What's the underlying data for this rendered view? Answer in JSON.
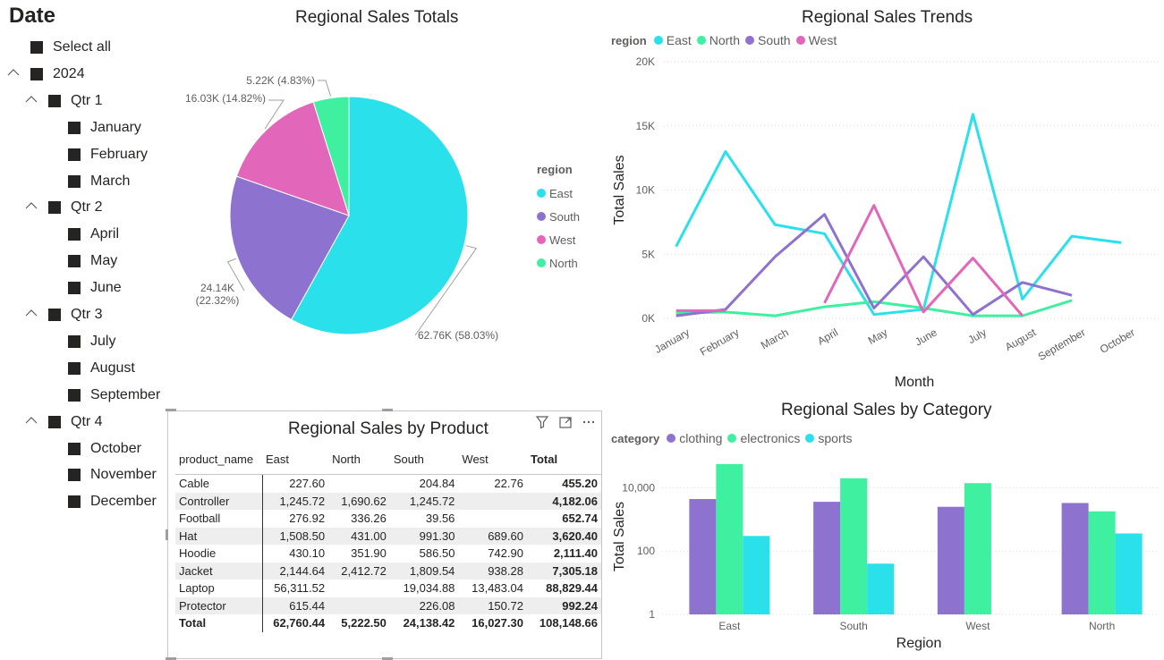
{
  "slicer": {
    "title": "Date",
    "items": [
      {
        "label": "Select all",
        "level": 0,
        "chevron": false
      },
      {
        "label": "2024",
        "level": 0,
        "chevron": true
      },
      {
        "label": "Qtr 1",
        "level": 1,
        "chevron": true
      },
      {
        "label": "January",
        "level": 2,
        "chevron": false
      },
      {
        "label": "February",
        "level": 2,
        "chevron": false
      },
      {
        "label": "March",
        "level": 2,
        "chevron": false
      },
      {
        "label": "Qtr 2",
        "level": 1,
        "chevron": true
      },
      {
        "label": "April",
        "level": 2,
        "chevron": false
      },
      {
        "label": "May",
        "level": 2,
        "chevron": false
      },
      {
        "label": "June",
        "level": 2,
        "chevron": false
      },
      {
        "label": "Qtr 3",
        "level": 1,
        "chevron": true
      },
      {
        "label": "July",
        "level": 2,
        "chevron": false
      },
      {
        "label": "August",
        "level": 2,
        "chevron": false
      },
      {
        "label": "September",
        "level": 2,
        "chevron": false
      },
      {
        "label": "Qtr 4",
        "level": 1,
        "chevron": true
      },
      {
        "label": "October",
        "level": 2,
        "chevron": false
      },
      {
        "label": "November",
        "level": 2,
        "chevron": false
      },
      {
        "label": "December",
        "level": 2,
        "chevron": false
      }
    ]
  },
  "colors": {
    "East": "#2ae0ea",
    "North": "#3ff0a0",
    "South": "#8e72cf",
    "West": "#e266b9",
    "clothing": "#8e72cf",
    "electronics": "#3ff0a0",
    "sports": "#2ae0ea"
  },
  "pie": {
    "title": "Regional Sales Totals",
    "legend_title": "region",
    "legend": [
      "East",
      "South",
      "West",
      "North"
    ]
  },
  "trend": {
    "title": "Regional Sales Trends",
    "legend_title": "region",
    "legend": [
      "East",
      "North",
      "South",
      "West"
    ]
  },
  "bars": {
    "title": "Regional Sales by Category",
    "legend_title": "category",
    "legend": [
      "clothing",
      "electronics",
      "sports"
    ]
  },
  "table": {
    "title": "Regional Sales by Product",
    "headers": [
      "product_name",
      "East",
      "North",
      "South",
      "West",
      "Total"
    ],
    "rows": [
      [
        "Cable",
        "227.60",
        "",
        "204.84",
        "22.76",
        "455.20"
      ],
      [
        "Controller",
        "1,245.72",
        "1,690.62",
        "1,245.72",
        "",
        "4,182.06"
      ],
      [
        "Football",
        "276.92",
        "336.26",
        "39.56",
        "",
        "652.74"
      ],
      [
        "Hat",
        "1,508.50",
        "431.00",
        "991.30",
        "689.60",
        "3,620.40"
      ],
      [
        "Hoodie",
        "430.10",
        "351.90",
        "586.50",
        "742.90",
        "2,111.40"
      ],
      [
        "Jacket",
        "2,144.64",
        "2,412.72",
        "1,809.54",
        "938.28",
        "7,305.18"
      ],
      [
        "Laptop",
        "56,311.52",
        "",
        "19,034.88",
        "13,483.04",
        "88,829.44"
      ],
      [
        "Protector",
        "615.44",
        "",
        "226.08",
        "150.72",
        "992.24"
      ]
    ],
    "total": [
      "Total",
      "62,760.44",
      "5,222.50",
      "24,138.42",
      "16,027.30",
      "108,148.66"
    ]
  },
  "chart_data": [
    {
      "type": "pie",
      "title": "Regional Sales Totals",
      "legend_title": "region",
      "slices": [
        {
          "name": "East",
          "value": 62760.44,
          "label": "62.76K (58.03%)"
        },
        {
          "name": "South",
          "value": 24138.42,
          "label": "24.14K (22.32%)"
        },
        {
          "name": "West",
          "value": 16027.3,
          "label": "16.03K (14.82%)"
        },
        {
          "name": "North",
          "value": 5222.5,
          "label": "5.22K (4.83%)"
        }
      ]
    },
    {
      "type": "line",
      "title": "Regional Sales Trends",
      "xlabel": "Month",
      "ylabel": "Total Sales",
      "categories": [
        "January",
        "February",
        "March",
        "April",
        "May",
        "June",
        "July",
        "August",
        "September",
        "October"
      ],
      "yticks": [
        "0K",
        "5K",
        "10K",
        "15K",
        "20K"
      ],
      "ylim": [
        0,
        20000
      ],
      "grid": true,
      "series": [
        {
          "name": "East",
          "values": [
            5600,
            13000,
            7300,
            6600,
            300,
            700,
            15900,
            1500,
            6400,
            5900
          ]
        },
        {
          "name": "North",
          "values": [
            400,
            500,
            200,
            900,
            1300,
            800,
            200,
            200,
            1400,
            null
          ]
        },
        {
          "name": "South",
          "values": [
            200,
            700,
            4800,
            8100,
            800,
            4800,
            300,
            2800,
            1800,
            null
          ]
        },
        {
          "name": "West",
          "values": [
            600,
            600,
            null,
            1200,
            8800,
            500,
            4700,
            200,
            null,
            null
          ]
        }
      ]
    },
    {
      "type": "bar",
      "title": "Regional Sales by Category",
      "xlabel": "Region",
      "ylabel": "Total Sales",
      "yscale": "log",
      "yticks": [
        "1",
        "100",
        "10,000"
      ],
      "categories": [
        "East",
        "South",
        "West",
        "North"
      ],
      "series": [
        {
          "name": "clothing",
          "values": [
            4400,
            3600,
            2500,
            3300
          ]
        },
        {
          "name": "electronics",
          "values": [
            56000,
            20000,
            14000,
            1800
          ]
        },
        {
          "name": "sports",
          "values": [
            300,
            40,
            null,
            360
          ]
        }
      ]
    }
  ]
}
